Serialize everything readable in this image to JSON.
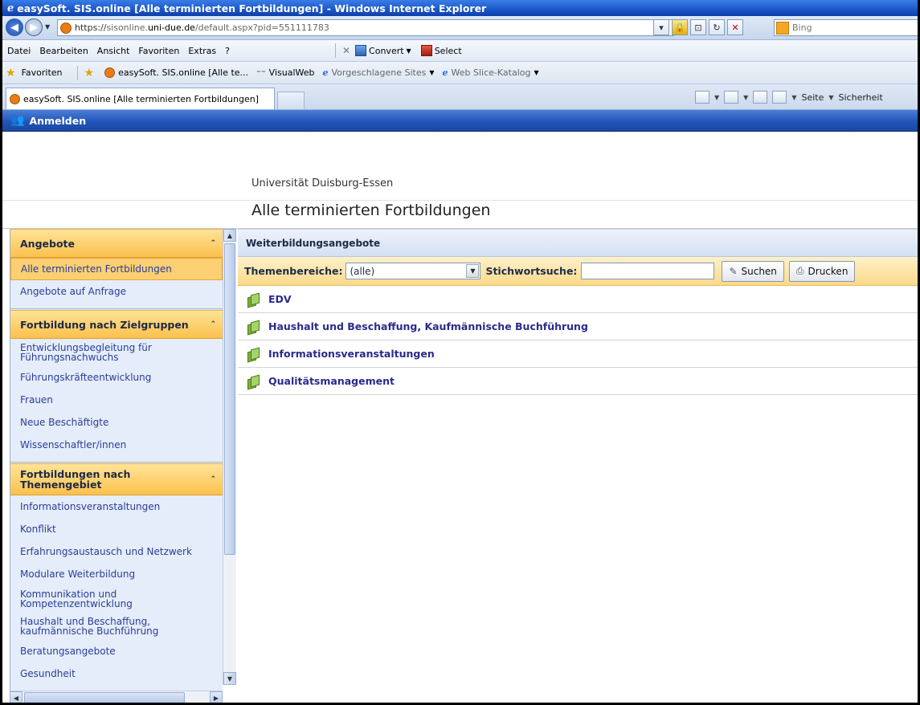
{
  "window": {
    "title": "easySoft. SIS.online [Alle terminierten Fortbildungen] - Windows Internet Explorer"
  },
  "addressbar": {
    "url_scheme": "https://",
    "url_host_prefix": "sisonline.",
    "url_host": "uni-due.de",
    "url_path": "/default.aspx?pid=551111783",
    "search_placeholder": "Bing"
  },
  "menubar": {
    "items": [
      "Datei",
      "Bearbeiten",
      "Ansicht",
      "Favoriten",
      "Extras",
      "?"
    ],
    "convert": "Convert",
    "select": "Select"
  },
  "favbar": {
    "favorites": "Favoriten",
    "items": [
      "easySoft. SIS.online [Alle te...",
      "VisualWeb",
      "Vorgeschlagene Sites",
      "Web Slice-Katalog"
    ]
  },
  "tabbar": {
    "active_tab": "easySoft. SIS.online [Alle terminierten Fortbildungen]",
    "cmd_seite": "Seite",
    "cmd_sicherheit": "Sicherheit"
  },
  "appbar": {
    "label": "Anmelden"
  },
  "header": {
    "university": "Universität Duisburg-Essen",
    "title": "Alle terminierten Fortbildungen"
  },
  "sidebar": {
    "sections": [
      {
        "title": "Angebote",
        "items": [
          "Alle terminierten Fortbildungen",
          "Angebote auf Anfrage"
        ]
      },
      {
        "title": "Fortbildung nach Zielgruppen",
        "items": [
          "Entwicklungsbegleitung für Führungsnachwuchs",
          "Führungskräfteentwicklung",
          "Frauen",
          "Neue Beschäftigte",
          "Wissenschaftler/innen"
        ]
      },
      {
        "title": "Fortbildungen nach Themengebiet",
        "items": [
          "Informationsveranstaltungen",
          "Konflikt",
          "Erfahrungsaustausch und Netzwerk",
          "Modulare Weiterbildung",
          "Kommunikation und Kompetenzentwicklung",
          "Haushalt und Beschaffung, kaufmännische Buchführung",
          "Beratungsangebote",
          "Gesundheit"
        ]
      }
    ]
  },
  "main": {
    "section_title": "Weiterbildungsangebote",
    "filter": {
      "themen_label": "Themenbereiche:",
      "themen_value": "(alle)",
      "stichwort_label": "Stichwortsuche:",
      "stichwort_value": "",
      "search_button": "Suchen",
      "print_button": "Drucken"
    },
    "categories": [
      "EDV",
      "Haushalt und Beschaffung, Kaufmännische Buchführung",
      "Informationsveranstaltungen",
      "Qualitätsmanagement"
    ]
  }
}
